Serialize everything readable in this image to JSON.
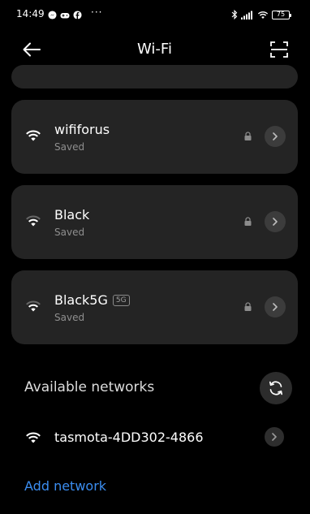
{
  "status_bar": {
    "time": "14:49",
    "more": "···",
    "battery": "75"
  },
  "header": {
    "title": "Wi-Fi"
  },
  "saved_networks": [
    {
      "name": "wififorus",
      "status": "Saved",
      "band": ""
    },
    {
      "name": "Black",
      "status": "Saved",
      "band": ""
    },
    {
      "name": "Black5G",
      "status": "Saved",
      "band": "5G"
    }
  ],
  "available": {
    "title": "Available networks",
    "networks": [
      {
        "name": "tasmota-4DD302-4866"
      }
    ]
  },
  "add_network_label": "Add network",
  "colors": {
    "background": "#000000",
    "card": "#242424",
    "accent": "#3b8df0"
  }
}
